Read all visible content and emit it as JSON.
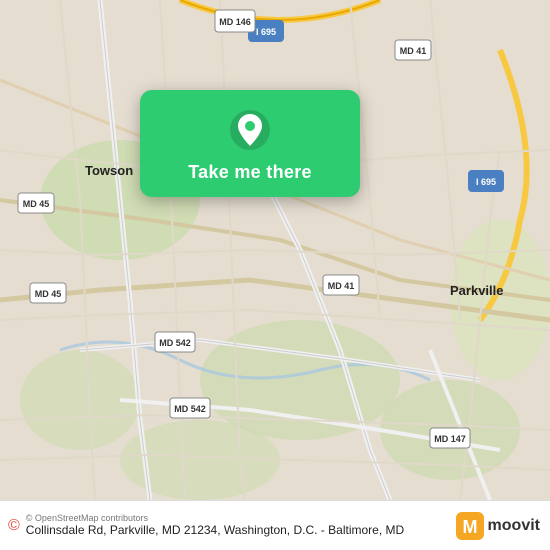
{
  "map": {
    "background_color": "#e8e0d8",
    "center_lat": 39.37,
    "center_lng": -76.57
  },
  "card": {
    "button_label": "Take me there",
    "bg_color": "#2ecc71"
  },
  "bottom_bar": {
    "osm_text": "© OpenStreetMap contributors",
    "address": "Collinsdale Rd, Parkville, MD 21234, Washington, D.C.\n- Baltimore, MD",
    "moovit_label": "moovit"
  },
  "map_labels": {
    "towson": "Towson",
    "parkville": "Parkville",
    "i695_1": "I 695",
    "i695_2": "I 695",
    "md146": "MD 146",
    "md45_1": "MD 45",
    "md45_2": "MD 45",
    "md41_1": "MD 41",
    "md41_2": "MD 41",
    "md542_1": "MD 542",
    "md542_2": "MD 542",
    "md147": "MD 147"
  },
  "icons": {
    "pin": "location-pin-icon",
    "osm_circle": "osm-circle-icon",
    "moovit_m": "moovit-m-icon"
  }
}
